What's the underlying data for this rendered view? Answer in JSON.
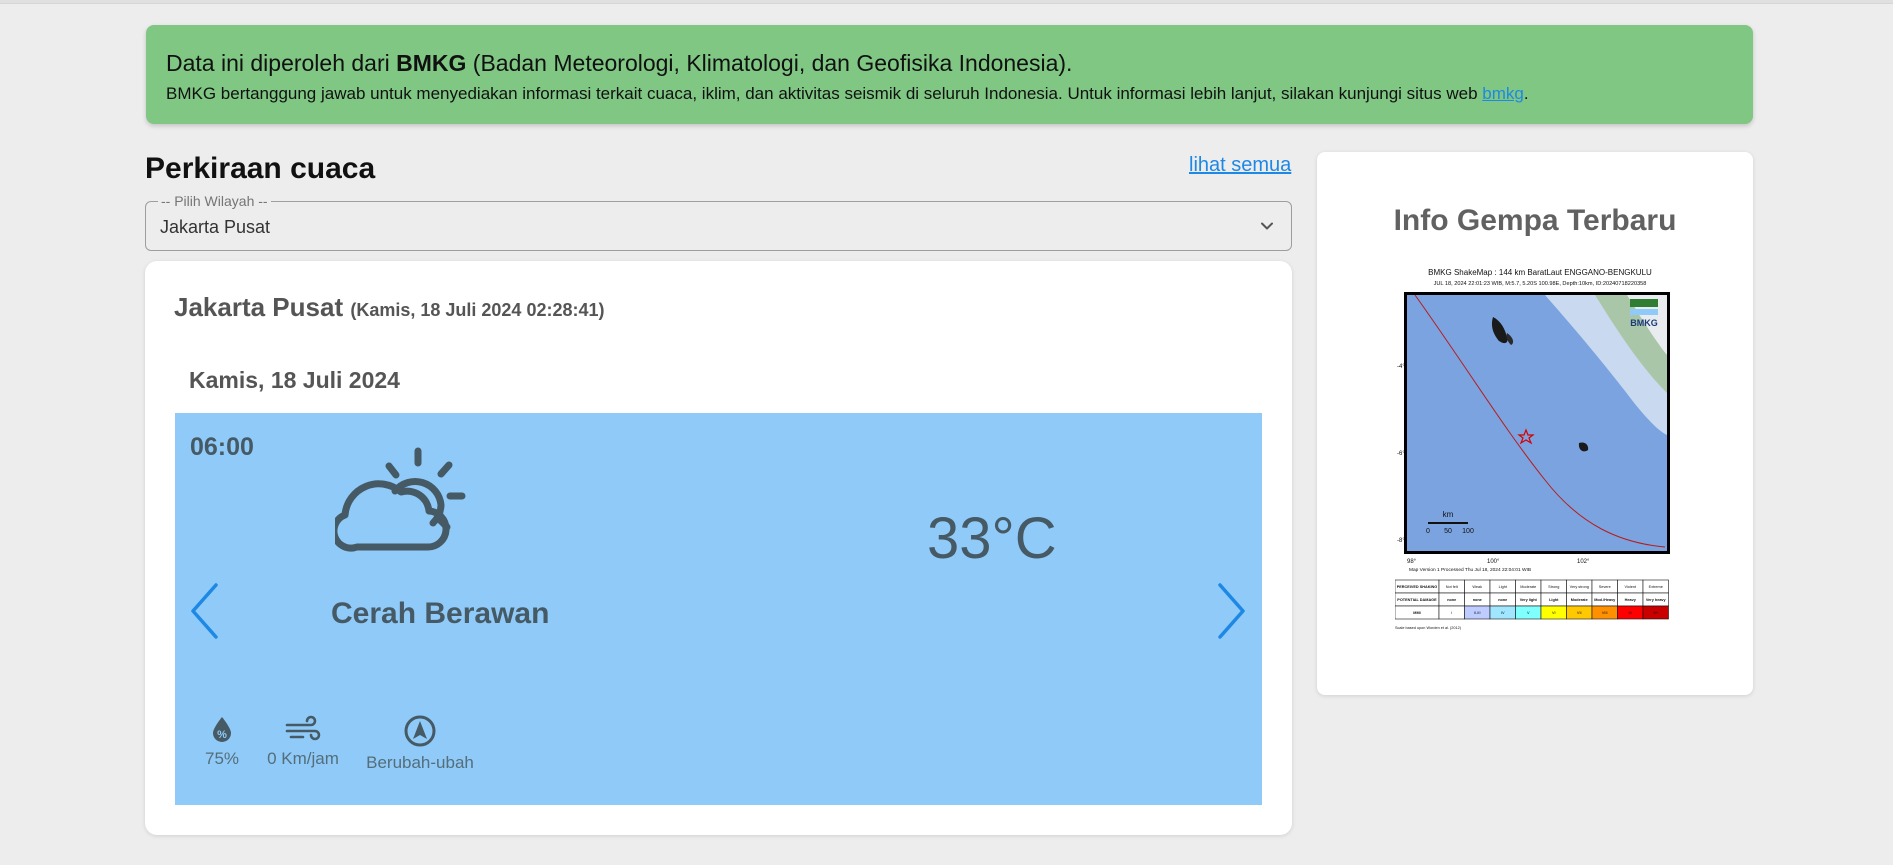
{
  "notice": {
    "title_prefix": "Data ini diperoleh dari ",
    "title_bold": "BMKG",
    "title_suffix": " (Badan Meteorologi, Klimatologi, dan Geofisika Indonesia).",
    "body_text": "BMKG bertanggung jawab untuk menyediakan informasi terkait cuaca, iklim, dan aktivitas seismik di seluruh Indonesia. Untuk informasi lebih lanjut, silakan kunjungi situs web ",
    "link_label": "bmkg",
    "body_end": "."
  },
  "forecast": {
    "heading": "Perkiraan cuaca",
    "see_all_label": "lihat semua",
    "region_legend": "-- Pilih Wilayah --",
    "region_value": "Jakarta Pusat",
    "location": "Jakarta Pusat",
    "timestamp": "(Kamis, 18 Juli 2024 02:28:41)",
    "day": "Kamis, 18 Juli 2024",
    "slide": {
      "time": "06:00",
      "icon": "partly-cloudy-icon",
      "description": "Cerah Berawan",
      "temperature": "33°C",
      "humidity": "75%",
      "wind_speed": "0 Km/jam",
      "wind_direction": "Berubah-ubah"
    }
  },
  "quake": {
    "title": "Info Gempa Terbaru",
    "map_title": "BMKG ShakeMap : 144 km BaratLaut ENGGANO-BENGKULU",
    "map_subtitle": "JUL 18, 2024 22:01:23 WIB, M:5.7, 5.20S 100.98E, Depth:10km, ID:20240718220358",
    "map_logo": "BMKG",
    "scale_unit": "km",
    "scale_ticks": [
      "0",
      "50",
      "100"
    ],
    "lat_labels": [
      "-4°",
      "-6°",
      "-8°"
    ],
    "lon_labels": [
      "98°",
      "100°",
      "102°"
    ],
    "map_version": "Map Version 1 Processed Thu Jul 18, 2024 22:04:01 WIB",
    "legend_rows": [
      "PERCEIVED SHAKING",
      "POTENTIAL DAMAGE",
      "MMI"
    ],
    "legend_shaking": [
      "Not felt",
      "Weak",
      "Light",
      "Moderate",
      "Strong",
      "Very strong",
      "Severe",
      "Violent",
      "Extreme"
    ],
    "legend_damage": [
      "none",
      "none",
      "none",
      "Very light",
      "Light",
      "Moderate",
      "Mod./Heavy",
      "Heavy",
      "Very heavy"
    ],
    "legend_mmi": [
      "I",
      "II-III",
      "IV",
      "V",
      "VI",
      "VII",
      "VIII",
      "IX",
      "X+"
    ],
    "legend_colors": [
      "#ffffff",
      "#bfccff",
      "#a0e6ff",
      "#80ffff",
      "#ffff00",
      "#ffc800",
      "#ff9100",
      "#ff0000",
      "#c80000"
    ],
    "footnote": "Scale based upon Worden et al. (2012)"
  },
  "colors": {
    "notice_bg": "#80c784",
    "slide_bg": "#90caf9",
    "link": "#1e88e5",
    "arrow": "#1e88e5"
  }
}
